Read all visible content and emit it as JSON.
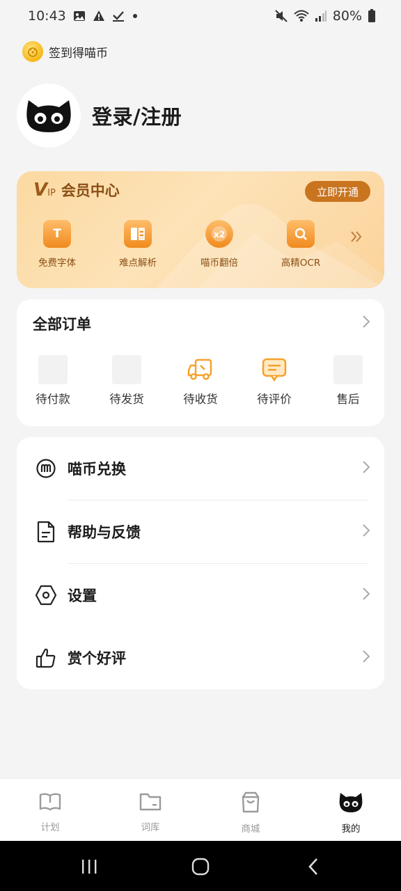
{
  "status_bar": {
    "time": "10:43",
    "battery": "80%",
    "icons": [
      "gallery-icon",
      "warning-icon",
      "check-icon",
      "dot-icon",
      "mute-icon",
      "wifi-icon",
      "signal-icon",
      "battery-icon"
    ]
  },
  "checkin": {
    "label": "签到得喵币",
    "icon": "coin-icon"
  },
  "profile": {
    "login_label": "登录/注册",
    "avatar_icon": "cat-avatar-icon"
  },
  "vip": {
    "logo": "V",
    "logo_sub": "IP",
    "title": "会员中心",
    "open_button": "立即开通",
    "items": [
      {
        "label": "免费字体",
        "icon": "font-icon"
      },
      {
        "label": "难点解析",
        "icon": "book-icon"
      },
      {
        "label": "喵币翻倍",
        "icon": "coin-x2-icon"
      },
      {
        "label": "高精OCR",
        "icon": "ocr-search-icon"
      }
    ],
    "more_icon": "double-chevron-right-icon",
    "accent": "#c9741f"
  },
  "orders": {
    "title": "全部订单",
    "items": [
      {
        "label": "待付款",
        "icon": "placeholder"
      },
      {
        "label": "待发货",
        "icon": "placeholder"
      },
      {
        "label": "待收货",
        "icon": "truck-icon"
      },
      {
        "label": "待评价",
        "icon": "comment-icon"
      },
      {
        "label": "售后",
        "icon": "placeholder"
      }
    ]
  },
  "menu": [
    {
      "label": "喵币兑换",
      "icon": "coin-m-icon"
    },
    {
      "label": "帮助与反馈",
      "icon": "document-icon"
    },
    {
      "label": "设置",
      "icon": "settings-hexagon-icon"
    },
    {
      "label": "赏个好评",
      "icon": "thumbs-up-icon"
    }
  ],
  "tabbar": [
    {
      "label": "计划",
      "icon": "book-open-icon",
      "active": false
    },
    {
      "label": "词库",
      "icon": "folder-icon",
      "active": false
    },
    {
      "label": "商城",
      "icon": "shopping-bag-icon",
      "active": false
    },
    {
      "label": "我的",
      "icon": "cat-face-icon",
      "active": true
    }
  ],
  "colors": {
    "orange_icon": "#f08a1e",
    "background": "#f4f4f5"
  }
}
